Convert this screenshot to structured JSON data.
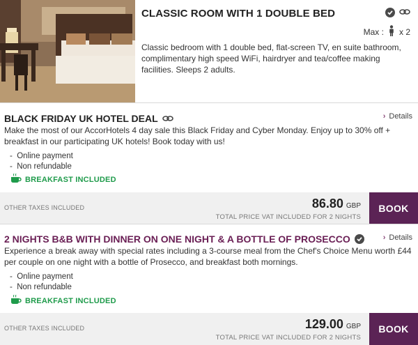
{
  "room": {
    "title": "CLASSIC ROOM WITH 1 DOUBLE BED",
    "max_label": "Max :",
    "max_count": "x 2",
    "description": "Classic bedroom with 1 double bed, flat-screen TV, en suite bathroom, complimentary high speed WiFi, hairdryer and tea/coffee making facilities. Sleeps 2 adults."
  },
  "offers": [
    {
      "title": "BLACK FRIDAY UK HOTEL DEAL",
      "details_label": "Details",
      "description": "Make the most of our AccorHotels 4 day sale this Black Friday and Cyber Monday. Enjoy up to 30% off + breakfast in our participating UK hotels! Book today with us!",
      "conditions": [
        "Online payment",
        "Non refundable"
      ],
      "breakfast_label": "BREAKFAST INCLUDED",
      "taxes_label": "OTHER TAXES INCLUDED",
      "price": "86.80",
      "currency": "GBP",
      "total_note": "TOTAL PRICE VAT INCLUDED FOR 2 NIGHTS",
      "book_label": "BOOK"
    },
    {
      "title": "2 NIGHTS B&B WITH DINNER ON ONE NIGHT & A BOTTLE OF PROSECCO",
      "details_label": "Details",
      "description": "Experience a break away with special rates including a 3-course meal from the Chef's Choice Menu worth £44 per couple on one night with a bottle of Prosecco, and breakfast both mornings.",
      "conditions": [
        "Online payment",
        "Non refundable"
      ],
      "breakfast_label": "BREAKFAST INCLUDED",
      "taxes_label": "OTHER TAXES INCLUDED",
      "price": "129.00",
      "currency": "GBP",
      "total_note": "TOTAL PRICE VAT INCLUDED FOR 2 NIGHTS",
      "book_label": "BOOK"
    }
  ],
  "colors": {
    "accent": "#5b2355",
    "offer_title_plum": "#6a1f55",
    "breakfast_green": "#1f9b4b",
    "price_bar": "#f0f0f0"
  },
  "icons": [
    "room-photo",
    "check-circle-icon",
    "link-chain-icon",
    "person-icon",
    "chevron-right-icon",
    "coffee-cup-icon"
  ]
}
